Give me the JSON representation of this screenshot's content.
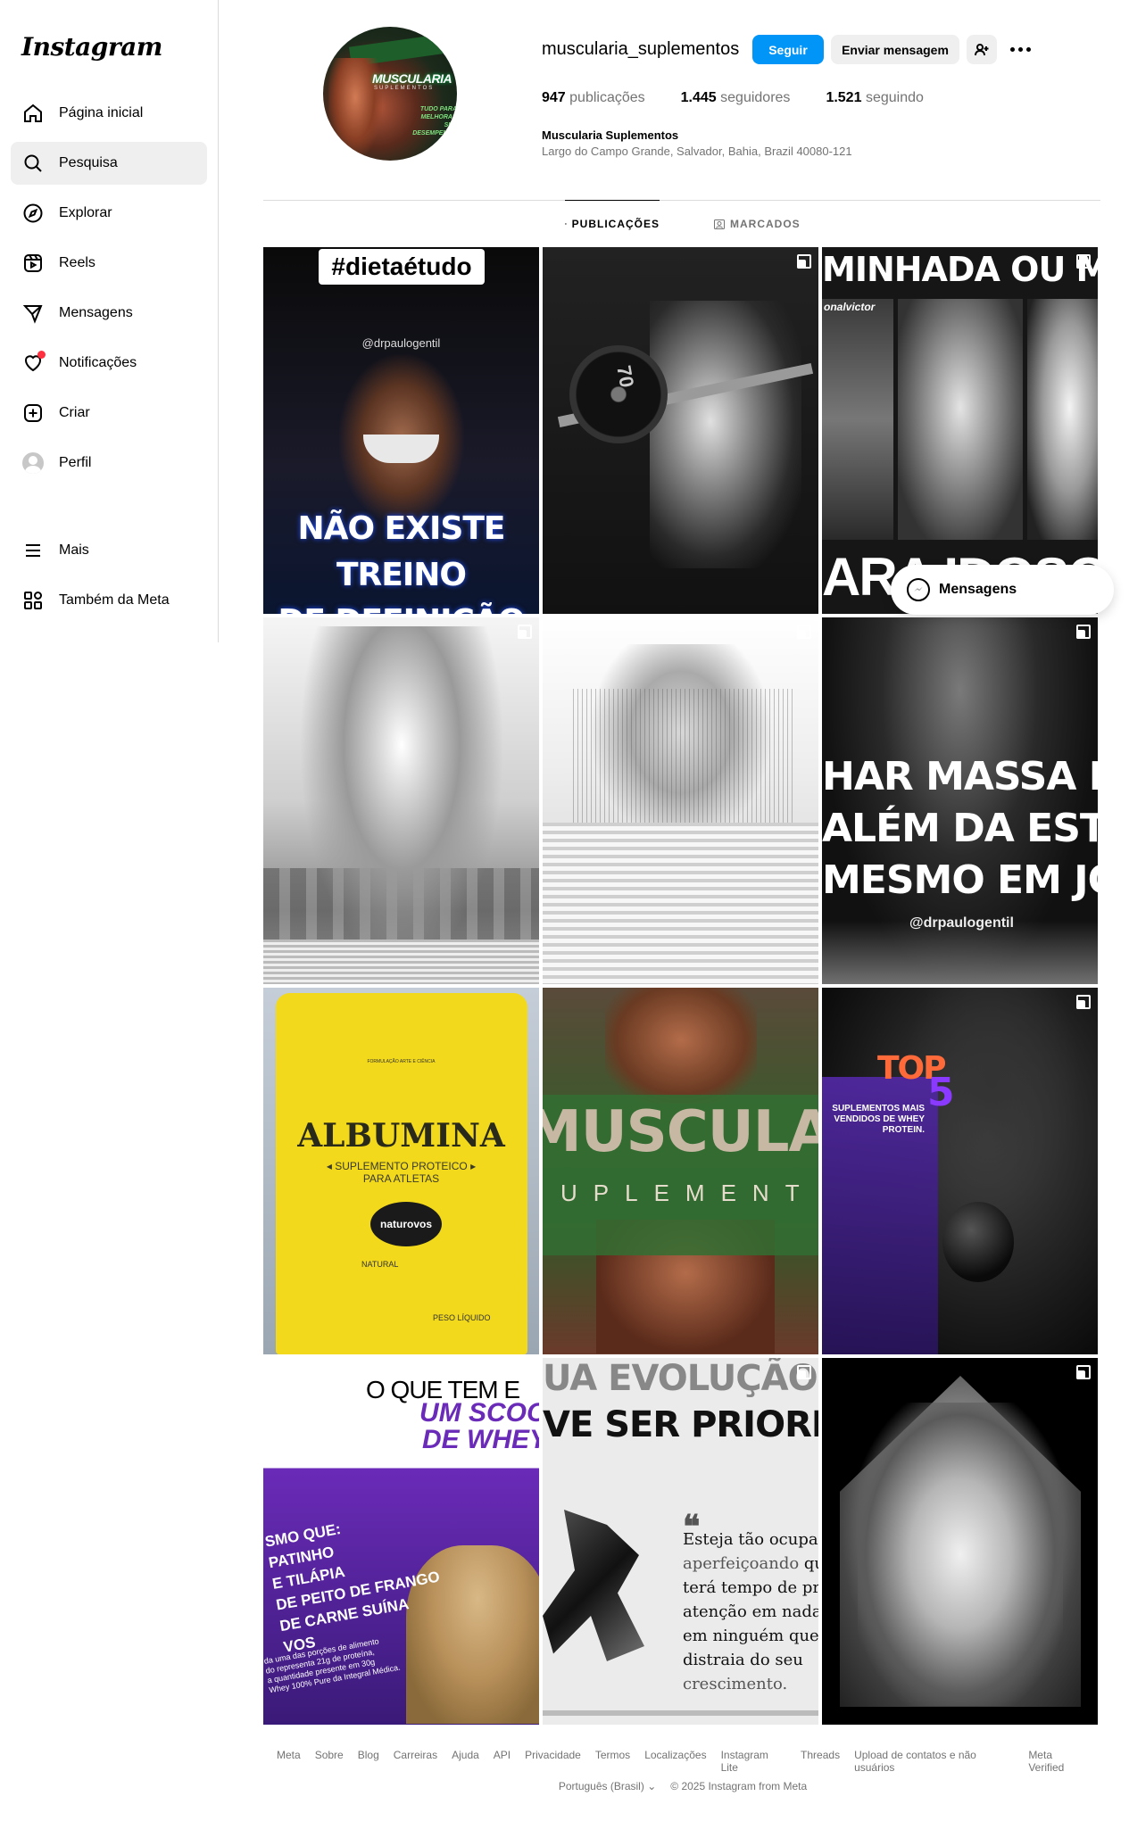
{
  "app": {
    "logo": "Instagram"
  },
  "sidebar": {
    "items": [
      {
        "label": "Página inicial",
        "icon": "home-icon"
      },
      {
        "label": "Pesquisa",
        "icon": "search-icon",
        "active": true
      },
      {
        "label": "Explorar",
        "icon": "compass-icon"
      },
      {
        "label": "Reels",
        "icon": "reels-icon"
      },
      {
        "label": "Mensagens",
        "icon": "messenger-icon"
      },
      {
        "label": "Notificações",
        "icon": "heart-icon",
        "badge_dot": true
      },
      {
        "label": "Criar",
        "icon": "plus-square-icon"
      },
      {
        "label": "Perfil",
        "icon": "avatar-icon"
      }
    ],
    "bottom": [
      {
        "label": "Mais",
        "icon": "menu-icon"
      },
      {
        "label": "Também da Meta",
        "icon": "meta-apps-icon"
      }
    ]
  },
  "profile": {
    "username": "muscularia_suplementos",
    "follow_label": "Seguir",
    "message_label": "Enviar mensagem",
    "stats": {
      "posts_count": "947",
      "posts_label": "publicações",
      "followers_count": "1.445",
      "followers_label": "seguidores",
      "following_count": "1.521",
      "following_label": "seguindo"
    },
    "full_name": "Muscularia Suplementos",
    "address": "Largo do Campo Grande, Salvador, Bahia, Brazil 40080-121",
    "avatar": {
      "brand": "MUSCULARIA",
      "brand_sub": "SUPLEMENTOS",
      "tagline_1": "TUDO PARA",
      "tagline_2": "MELHORAR SEU",
      "tagline_3": "DESEMPENHO"
    }
  },
  "tabs": [
    {
      "label": "PUBLICAÇÕES",
      "active": true
    },
    {
      "label": "MARCADOS",
      "active": false
    }
  ],
  "posts": {
    "p1": {
      "hashtag": "#dietaétudo",
      "handle": "@drpaulogentil",
      "line1": "NÃO EXISTE TREINO",
      "line2": "DE DEFINIÇÃO"
    },
    "p2": {
      "plate": "70"
    },
    "p3": {
      "headline": "MINHADA OU MUSCULAÇ",
      "sub": "onalvictor",
      "footer": "ARA IDOSOS"
    },
    "p6": {
      "line1": "HAR MASSA MAG",
      "line2": "ALÉM DA ESTÉTIC",
      "line3": "MESMO EM JOVENS",
      "handle": "@drpaulogentil"
    },
    "p7": {
      "top": "FORMULAÇÃO ARTE E CIÊNCIA",
      "title": "ALBUMINA",
      "sub1": "◂ SUPLEMENTO PROTEICO ▸",
      "sub2": "PARA ATLETAS",
      "brand": "naturovos",
      "natural": "NATURAL",
      "peso": "PESO LÍQUIDO"
    },
    "p8": {
      "brand": "MUSCULA",
      "sub": "UPLEMENT"
    },
    "p9": {
      "top": "TOP",
      "five": "5",
      "text": "SUPLEMENTOS MAIS VENDIDOS DE WHEY PROTEIN."
    },
    "p10": {
      "q": "O QUE TEM E",
      "scoop": "UM SCOO",
      "whey": "DE WHEY",
      "l1": "SMO QUE:",
      "l2": "PATINHO",
      "l3": "E TILÁPIA",
      "l4": "DE PEITO DE FRANGO",
      "l5": "DE CARNE SUÍNA",
      "l6": "VOS",
      "fine1": "da uma das porções de alimento",
      "fine2": "do representa 21g de proteína,",
      "fine3": "a quantidade presente em 30g",
      "fine4": "Whey 100% Pure da Integral Médica."
    },
    "p11": {
      "h1": "UA EVOLUÇÃO PESSO",
      "h2": "VE SER PRIORIDA",
      "mark": "❝",
      "q1": "Esteja tão ocupado",
      "q2a": "aperfeiçoando",
      "q2b": " que",
      "q3": "terá tempo de pres",
      "q4": "atenção em nada n",
      "q5": "em ninguém que o",
      "q6": "distraia do seu",
      "q7": "crescimento."
    }
  },
  "messages_pill": {
    "label": "Mensagens"
  },
  "footer": {
    "links": [
      "Meta",
      "Sobre",
      "Blog",
      "Carreiras",
      "Ajuda",
      "API",
      "Privacidade",
      "Termos",
      "Localizações",
      "Instagram Lite",
      "Threads",
      "Upload de contatos e não usuários",
      "Meta Verified"
    ],
    "language": "Português (Brasil)",
    "copyright": "© 2025 Instagram from Meta"
  },
  "colors": {
    "accent": "#0095f6",
    "notification": "#ff3040",
    "muted": "#737373"
  }
}
